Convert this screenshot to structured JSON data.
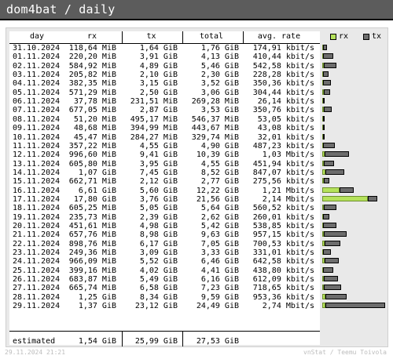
{
  "title": "dom4bat / daily",
  "headers": {
    "day": "day",
    "rx": "rx",
    "tx": "tx",
    "total": "total",
    "rate": "avg. rate"
  },
  "legend": {
    "rx": "rx",
    "tx": "tx"
  },
  "rows": [
    {
      "day": "31.10.2024",
      "rx": "118,64 MiB",
      "tx": "1,64 GiB",
      "total": "1,76 GiB",
      "rate": "174,91 kbit/s",
      "rx_frac": 0.0048,
      "tx_frac": 0.067
    },
    {
      "day": "01.11.2024",
      "rx": "220,20 MiB",
      "tx": "3,91 GiB",
      "total": "4,13 GiB",
      "rate": "410,44 kbit/s",
      "rx_frac": 0.0088,
      "tx_frac": 0.16
    },
    {
      "day": "02.11.2024",
      "rx": "584,92 MiB",
      "tx": "4,89 GiB",
      "total": "5,46 GiB",
      "rate": "542,58 kbit/s",
      "rx_frac": 0.023,
      "tx_frac": 0.199
    },
    {
      "day": "03.11.2024",
      "rx": "205,82 MiB",
      "tx": "2,10 GiB",
      "total": "2,30 GiB",
      "rate": "228,28 kbit/s",
      "rx_frac": 0.008,
      "tx_frac": 0.086
    },
    {
      "day": "04.11.2024",
      "rx": "382,35 MiB",
      "tx": "3,15 GiB",
      "total": "3,52 GiB",
      "rate": "350,36 kbit/s",
      "rx_frac": 0.015,
      "tx_frac": 0.128
    },
    {
      "day": "05.11.2024",
      "rx": "571,29 MiB",
      "tx": "2,50 GiB",
      "total": "3,06 GiB",
      "rate": "304,44 kbit/s",
      "rx_frac": 0.023,
      "tx_frac": 0.102
    },
    {
      "day": "06.11.2024",
      "rx": "37,78 MiB",
      "tx": "231,51 MiB",
      "total": "269,28 MiB",
      "rate": "26,14 kbit/s",
      "rx_frac": 0.0015,
      "tx_frac": 0.009
    },
    {
      "day": "07.11.2024",
      "rx": "677,05 MiB",
      "tx": "2,87 GiB",
      "total": "3,53 GiB",
      "rate": "350,76 kbit/s",
      "rx_frac": 0.027,
      "tx_frac": 0.117
    },
    {
      "day": "08.11.2024",
      "rx": "51,20 MiB",
      "tx": "495,17 MiB",
      "total": "546,37 MiB",
      "rate": "53,05 kbit/s",
      "rx_frac": 0.002,
      "tx_frac": 0.02
    },
    {
      "day": "09.11.2024",
      "rx": "48,68 MiB",
      "tx": "394,99 MiB",
      "total": "443,67 MiB",
      "rate": "43,08 kbit/s",
      "rx_frac": 0.002,
      "tx_frac": 0.016
    },
    {
      "day": "10.11.2024",
      "rx": "45,47 MiB",
      "tx": "284,27 MiB",
      "total": "329,74 MiB",
      "rate": "32,01 kbit/s",
      "rx_frac": 0.0018,
      "tx_frac": 0.011
    },
    {
      "day": "11.11.2024",
      "rx": "357,22 MiB",
      "tx": "4,55 GiB",
      "total": "4,90 GiB",
      "rate": "487,23 kbit/s",
      "rx_frac": 0.014,
      "tx_frac": 0.186
    },
    {
      "day": "12.11.2024",
      "rx": "996,60 MiB",
      "tx": "9,41 GiB",
      "total": "10,39 GiB",
      "rate": "1,03 Mbit/s",
      "rx_frac": 0.04,
      "tx_frac": 0.384
    },
    {
      "day": "13.11.2024",
      "rx": "605,80 MiB",
      "tx": "3,95 GiB",
      "total": "4,55 GiB",
      "rate": "451,94 kbit/s",
      "rx_frac": 0.024,
      "tx_frac": 0.161
    },
    {
      "day": "14.11.2024",
      "rx": "1,07 GiB",
      "tx": "7,45 GiB",
      "total": "8,52 GiB",
      "rate": "847,07 kbit/s",
      "rx_frac": 0.044,
      "tx_frac": 0.304
    },
    {
      "day": "15.11.2024",
      "rx": "662,71 MiB",
      "tx": "2,12 GiB",
      "total": "2,77 GiB",
      "rate": "275,56 kbit/s",
      "rx_frac": 0.026,
      "tx_frac": 0.087
    },
    {
      "day": "16.11.2024",
      "rx": "6,61 GiB",
      "tx": "5,60 GiB",
      "total": "12,22 GiB",
      "rate": "1,21 Mbit/s",
      "rx_frac": 0.27,
      "tx_frac": 0.229
    },
    {
      "day": "17.11.2024",
      "rx": "17,80 GiB",
      "tx": "3,76 GiB",
      "total": "21,56 GiB",
      "rate": "2,14 Mbit/s",
      "rx_frac": 0.727,
      "tx_frac": 0.154
    },
    {
      "day": "18.11.2024",
      "rx": "605,25 MiB",
      "tx": "5,05 GiB",
      "total": "5,64 GiB",
      "rate": "560,52 kbit/s",
      "rx_frac": 0.024,
      "tx_frac": 0.206
    },
    {
      "day": "19.11.2024",
      "rx": "235,73 MiB",
      "tx": "2,39 GiB",
      "total": "2,62 GiB",
      "rate": "260,01 kbit/s",
      "rx_frac": 0.009,
      "tx_frac": 0.098
    },
    {
      "day": "20.11.2024",
      "rx": "451,61 MiB",
      "tx": "4,98 GiB",
      "total": "5,42 GiB",
      "rate": "538,85 kbit/s",
      "rx_frac": 0.018,
      "tx_frac": 0.203
    },
    {
      "day": "21.11.2024",
      "rx": "657,76 MiB",
      "tx": "8,98 GiB",
      "total": "9,63 GiB",
      "rate": "957,15 kbit/s",
      "rx_frac": 0.026,
      "tx_frac": 0.367
    },
    {
      "day": "22.11.2024",
      "rx": "898,76 MiB",
      "tx": "6,17 GiB",
      "total": "7,05 GiB",
      "rate": "700,53 kbit/s",
      "rx_frac": 0.036,
      "tx_frac": 0.252
    },
    {
      "day": "23.11.2024",
      "rx": "249,36 MiB",
      "tx": "3,09 GiB",
      "total": "3,33 GiB",
      "rate": "331,01 kbit/s",
      "rx_frac": 0.01,
      "tx_frac": 0.126
    },
    {
      "day": "24.11.2024",
      "rx": "966,09 MiB",
      "tx": "5,52 GiB",
      "total": "6,46 GiB",
      "rate": "642,58 kbit/s",
      "rx_frac": 0.039,
      "tx_frac": 0.225
    },
    {
      "day": "25.11.2024",
      "rx": "399,16 MiB",
      "tx": "4,02 GiB",
      "total": "4,41 GiB",
      "rate": "438,80 kbit/s",
      "rx_frac": 0.016,
      "tx_frac": 0.164
    },
    {
      "day": "26.11.2024",
      "rx": "683,87 MiB",
      "tx": "5,49 GiB",
      "total": "6,16 GiB",
      "rate": "612,09 kbit/s",
      "rx_frac": 0.027,
      "tx_frac": 0.224
    },
    {
      "day": "27.11.2024",
      "rx": "665,74 MiB",
      "tx": "6,58 GiB",
      "total": "7,23 GiB",
      "rate": "718,65 kbit/s",
      "rx_frac": 0.027,
      "tx_frac": 0.269
    },
    {
      "day": "28.11.2024",
      "rx": "1,25 GiB",
      "tx": "8,34 GiB",
      "total": "9,59 GiB",
      "rate": "953,36 kbit/s",
      "rx_frac": 0.051,
      "tx_frac": 0.34
    },
    {
      "day": "29.11.2024",
      "rx": "1,37 GiB",
      "tx": "23,12 GiB",
      "total": "24,49 GiB",
      "rate": "2,74 Mbit/s",
      "rx_frac": 0.056,
      "tx_frac": 0.944
    }
  ],
  "estimated": {
    "label": "estimated",
    "rx": "1,54 GiB",
    "tx": "25,99 GiB",
    "total": "27,53 GiB"
  },
  "footer": {
    "timestamp": "29.11.2024 21:21",
    "credit": "vnStat / Teemu Toivola"
  },
  "colors": {
    "rx": "#b5e25b",
    "tx": "#6d6d6d",
    "titlebar": "#5c5c5c"
  }
}
